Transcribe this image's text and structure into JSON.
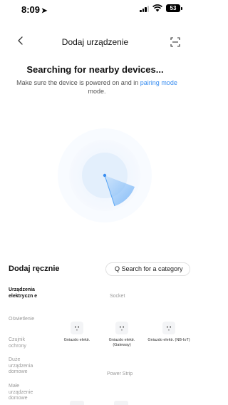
{
  "status_bar": {
    "time": "8:09",
    "battery": "53"
  },
  "nav": {
    "title": "Dodaj urządzenie"
  },
  "search": {
    "title": "Searching for nearby devices...",
    "desc_before": "Make sure the device is powered on and in",
    "desc_link": "pairing mode",
    "desc_after": "mode."
  },
  "manual": {
    "title": "Dodaj ręcznie",
    "search_placeholder": "Q Search for a category"
  },
  "sidebar": {
    "items": [
      {
        "label": "Urządzenia elektryczn e",
        "active": true
      },
      {
        "label": "Oświetlenie",
        "active": false
      },
      {
        "label": "Czujnik ochrony",
        "active": false
      },
      {
        "label": "Duże urządzenia domowe",
        "active": false
      },
      {
        "label": "Małe urządzenie domowe",
        "active": false
      }
    ]
  },
  "sections": [
    {
      "title": "Socket",
      "devices": [
        {
          "label": "Gniazdo elektr.",
          "icon": "socket-icon"
        },
        {
          "label": "Gniazdo elektr. (Gateway)",
          "icon": "socket-icon"
        },
        {
          "label": "Gniazdo elektr. (NB-IoT)",
          "icon": "socket-icon"
        }
      ]
    },
    {
      "title": "Power Strip",
      "devices": []
    }
  ],
  "colors": {
    "accent": "#3a8ef0",
    "radar": "#5aa6f5",
    "muted": "#9a9a9a"
  }
}
